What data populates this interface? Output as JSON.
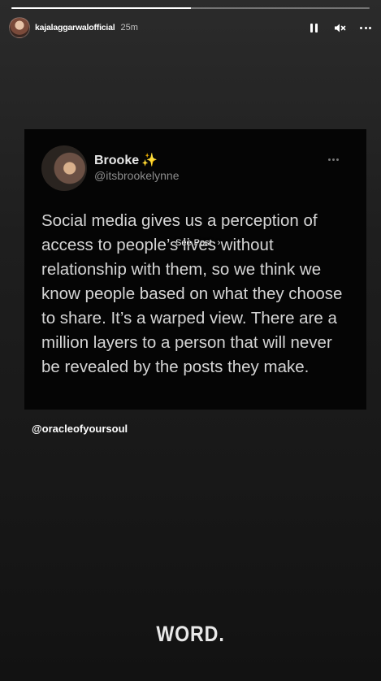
{
  "story": {
    "progress": 0.5,
    "username": "kajalaggarwalofficial",
    "time": "25m",
    "controls": {
      "pause_icon": "pause-icon",
      "mute_icon": "speaker-muted-icon",
      "more_icon": "more-horizontal-icon"
    }
  },
  "tweet": {
    "name": "Brooke",
    "sparkle": "✨",
    "handle": "@itsbrookelynne",
    "text": "Social media gives us a perception of access to people’s lives without relationship with them, so we think we know people based on what they choose to share. It’s a warped view. There are a million layers to a person that will never be revealed by the posts they make."
  },
  "see_post": {
    "label": "See Post",
    "chevron": "›"
  },
  "mention": "@oracleofyoursoul",
  "caption": "WORD."
}
